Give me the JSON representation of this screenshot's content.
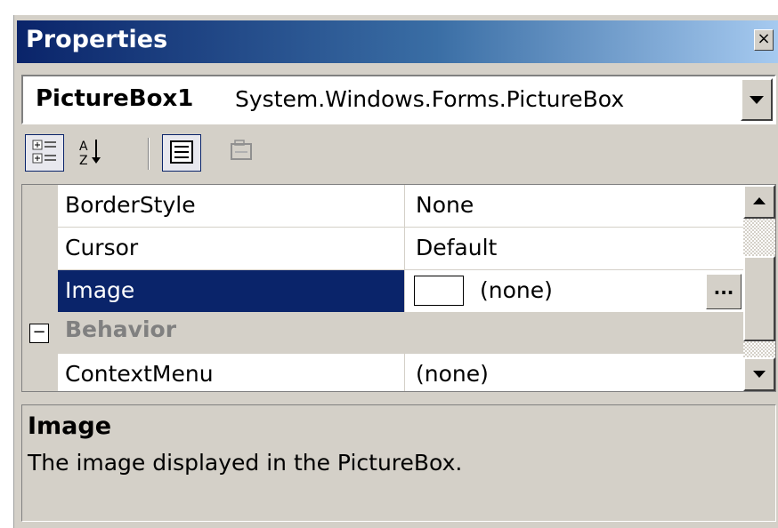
{
  "window": {
    "title": "Properties",
    "close_glyph": "×"
  },
  "object_selector": {
    "name": "PictureBox1",
    "type": "System.Windows.Forms.PictureBox"
  },
  "toolbar": {
    "buttons": [
      {
        "icon": "categorized-icon",
        "pressed": true
      },
      {
        "icon": "alphabetical-icon",
        "pressed": false
      },
      {
        "icon": "properties-icon",
        "pressed": true
      },
      {
        "icon": "property-pages-icon",
        "pressed": false
      }
    ]
  },
  "grid": {
    "rows": [
      {
        "name": "BorderStyle",
        "value": "None"
      },
      {
        "name": "Cursor",
        "value": "Default"
      },
      {
        "name": "Image",
        "value": "(none)",
        "selected": true,
        "ellipsis": "..."
      }
    ],
    "category": {
      "toggle": "−",
      "label": "Behavior"
    },
    "partial_row": {
      "name": "ContextMenu",
      "value": "(none)"
    }
  },
  "description": {
    "title": "Image",
    "text": "The image displayed in the PictureBox."
  },
  "colors": {
    "title_gradient_start": "#0a246a",
    "title_gradient_end": "#a6caf0",
    "selection": "#0a246a",
    "face": "#d4d0c8"
  }
}
